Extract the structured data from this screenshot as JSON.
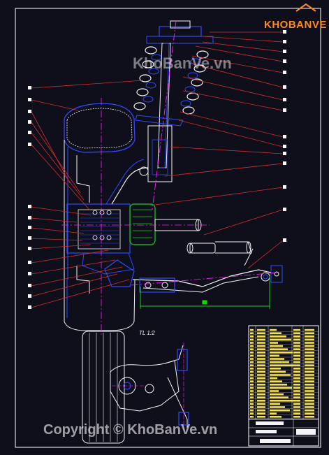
{
  "watermark_top": "KhoBanVe.vn",
  "watermark_bottom": "Copyright © KhoBanVe.vn",
  "logo": {
    "name": "KhoBanVe",
    "text": "KHOBANVE"
  },
  "scale_label": "TL 1:2",
  "colors": {
    "background": "#0f0f1b",
    "frame": "#ffffff",
    "leader": "#d42d2d",
    "centerline": "#ff1aff",
    "component_blue": "#2f4bff",
    "component_white": "#f4f4f4",
    "dimension_green": "#12d612",
    "title_block": "#f5e04c",
    "logo_orange": "#ff8a1e"
  },
  "icons": [
    "drawing-frame-icon",
    "wheel-tire-icon",
    "strut-spring-icon",
    "control-arm-icon",
    "title-block-icon",
    "part-marker-icon"
  ]
}
